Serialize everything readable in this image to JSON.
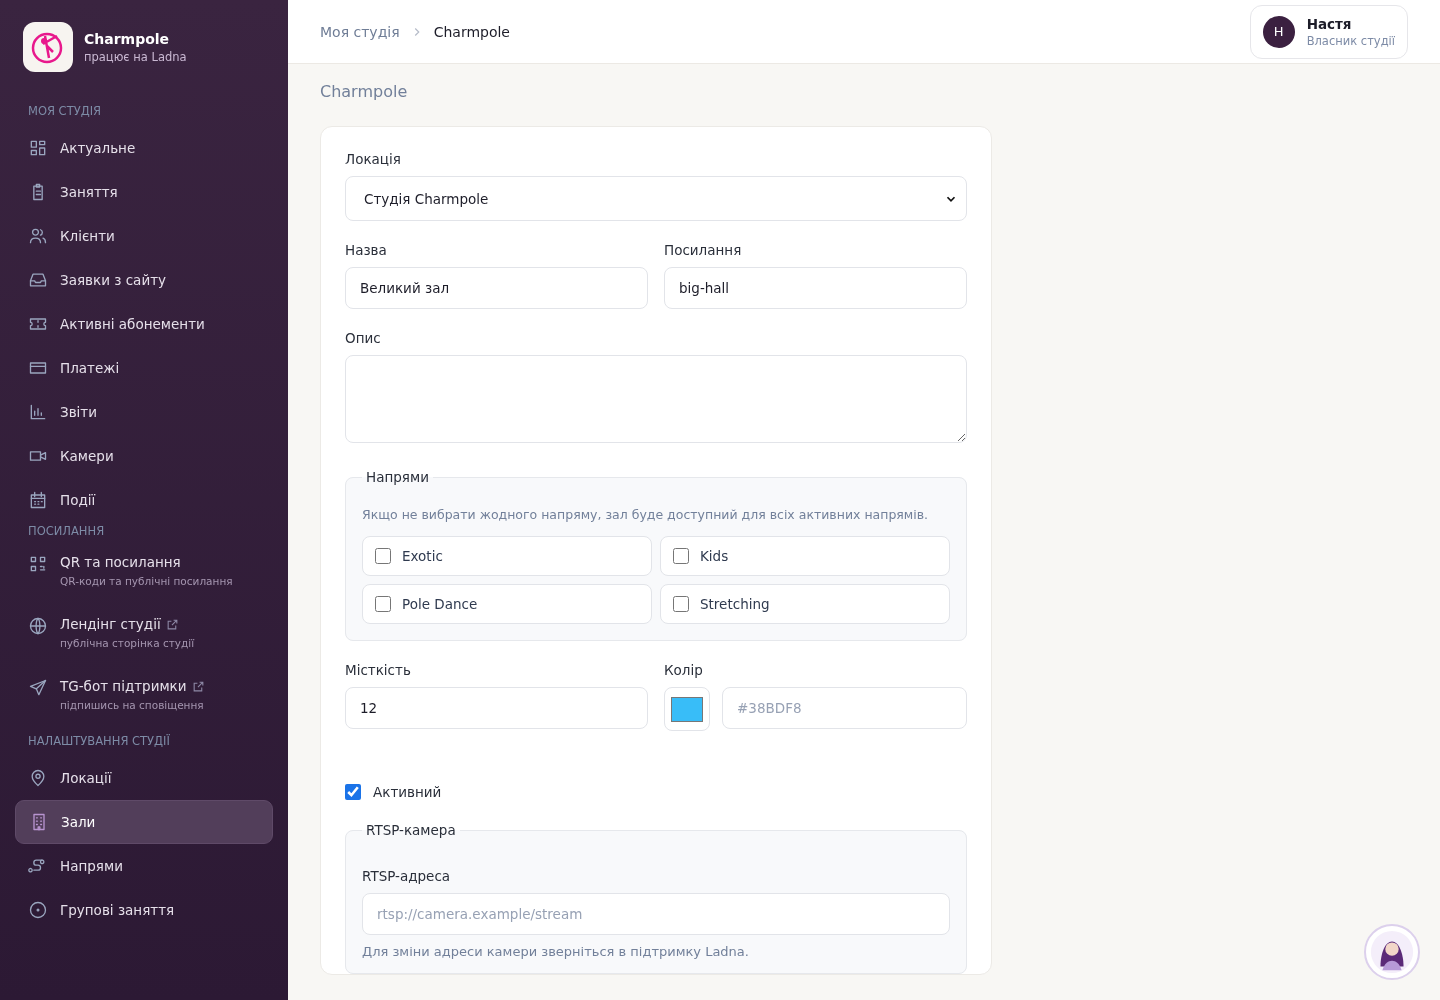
{
  "brand": {
    "name": "Charmpole",
    "tagline": "працює на Ladna"
  },
  "sidebar": {
    "sections": [
      {
        "title": "МОЯ СТУДІЯ",
        "items": [
          {
            "label": "Актуальне",
            "selected": false,
            "external": false
          },
          {
            "label": "Заняття",
            "selected": false,
            "external": false
          },
          {
            "label": "Клієнти",
            "selected": false,
            "external": false
          },
          {
            "label": "Заявки з сайту",
            "selected": false,
            "external": false
          },
          {
            "label": "Активні абонементи",
            "selected": false,
            "external": false
          },
          {
            "label": "Платежі",
            "selected": false,
            "external": false
          },
          {
            "label": "Звіти",
            "selected": false,
            "external": false
          },
          {
            "label": "Камери",
            "selected": false,
            "external": false
          },
          {
            "label": "Події",
            "selected": false,
            "external": false
          }
        ]
      },
      {
        "title": "ПОСИЛАННЯ",
        "items": [
          {
            "label": "QR та посилання",
            "sub": "QR-коди та публічні посилання",
            "selected": false,
            "external": false
          },
          {
            "label": "Лендінг студії",
            "sub": "публічна сторінка студії",
            "selected": false,
            "external": true
          },
          {
            "label": "TG-бот підтримки",
            "sub": "підпишись на сповіщення",
            "selected": false,
            "external": true
          }
        ]
      },
      {
        "title": "НАЛАШТУВАННЯ СТУДІЇ",
        "items": [
          {
            "label": "Локації",
            "selected": false,
            "external": false
          },
          {
            "label": "Зали",
            "selected": true,
            "external": false
          },
          {
            "label": "Напрями",
            "selected": false,
            "external": false
          },
          {
            "label": "Групові заняття",
            "selected": false,
            "external": false
          }
        ]
      }
    ]
  },
  "breadcrumbs": [
    "Моя студія",
    "Charmpole"
  ],
  "user": {
    "initial": "Н",
    "name": "Настя",
    "role": "Власник студії"
  },
  "subtitle": "Charmpole",
  "form": {
    "location": {
      "label": "Локація",
      "value": "Студія Charmpole"
    },
    "name": {
      "label": "Назва",
      "value": "Великий зал"
    },
    "slug": {
      "label": "Посилання",
      "value": "big-hall"
    },
    "description": {
      "label": "Опис"
    },
    "directions": {
      "legend": "Напрями",
      "hint": "Якщо не вибрати жодного напряму, зал буде доступний для всіх активних напрямів.",
      "options": [
        {
          "label": "Exotic",
          "checked": false
        },
        {
          "label": "Kids",
          "checked": false
        },
        {
          "label": "Pole Dance",
          "checked": false
        },
        {
          "label": "Stretching",
          "checked": false
        }
      ]
    },
    "capacity": {
      "label": "Місткість",
      "value": "12"
    },
    "color": {
      "label": "Колір",
      "placeholder": "#38BDF8"
    },
    "active": {
      "label": "Активний",
      "checked": true
    },
    "rtsp": {
      "legend": "RTSP-камера",
      "label": "RTSP-адреса",
      "placeholder": "rtsp://camera.example/stream",
      "hint": "Для зміни адреси камери зверніться в підтримку Ladna."
    }
  }
}
